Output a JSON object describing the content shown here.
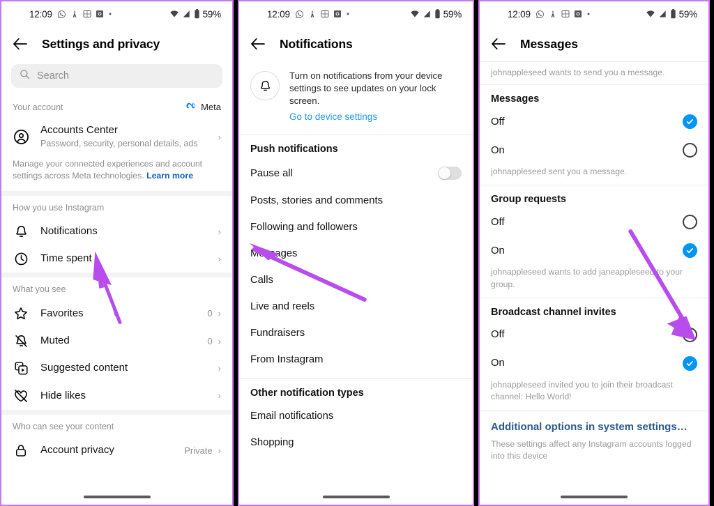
{
  "status_bar": {
    "time": "12:09",
    "battery_pct": "59%",
    "left_icons": [
      "whatsapp-icon",
      "app-icon",
      "photo-app-icon",
      "app-badge-icon",
      "dot-icon"
    ],
    "right_icons": [
      "wifi-icon",
      "signal-icon",
      "battery-icon"
    ]
  },
  "accent": {
    "arrow": "#b84ced",
    "phone_border": "#c979f0",
    "blue": "#0095f6",
    "link_blue": "#2196f3",
    "meta_blue": "#0082fb",
    "system_link": "#2b5a8e"
  },
  "panel_settings": {
    "title": "Settings and privacy",
    "search_placeholder": "Search",
    "search_value": "",
    "sections": [
      {
        "label": "Your account",
        "badge": "Meta",
        "rows": [
          {
            "icon": "account-circle-icon",
            "title": "Accounts Center",
            "sub": "Password, security, personal details, ads",
            "right": "",
            "chevron": true
          }
        ],
        "note": "Manage your connected experiences and account settings across Meta technologies.",
        "note_link": "Learn more"
      },
      {
        "label": "How you use Instagram",
        "rows": [
          {
            "icon": "bell-icon",
            "title": "Notifications",
            "sub": "",
            "right": "",
            "chevron": true
          },
          {
            "icon": "clock-icon",
            "title": "Time spent",
            "sub": "",
            "right": "",
            "chevron": true
          }
        ]
      },
      {
        "label": "What you see",
        "rows": [
          {
            "icon": "star-icon",
            "title": "Favorites",
            "sub": "",
            "right": "0",
            "chevron": true
          },
          {
            "icon": "bell-muted-icon",
            "title": "Muted",
            "sub": "",
            "right": "0",
            "chevron": true
          },
          {
            "icon": "suggested-content-icon",
            "title": "Suggested content",
            "sub": "",
            "right": "",
            "chevron": true
          },
          {
            "icon": "heart-slash-icon",
            "title": "Hide likes",
            "sub": "",
            "right": "",
            "chevron": true
          }
        ]
      },
      {
        "label": "Who can see your content",
        "rows": [
          {
            "icon": "lock-icon",
            "title": "Account privacy",
            "sub": "",
            "right": "Private",
            "chevron": true
          }
        ]
      }
    ]
  },
  "panel_notifications": {
    "title": "Notifications",
    "banner": {
      "icon": "bell-icon",
      "text": "Turn on notifications from your device settings to see updates on your lock screen.",
      "link": "Go to device settings"
    },
    "groups": [
      {
        "heading": "Push notifications",
        "items": [
          {
            "label": "Pause all",
            "control": "toggle",
            "toggle_on": false
          },
          {
            "label": "Posts, stories and comments",
            "control": "none"
          },
          {
            "label": "Following and followers",
            "control": "none"
          },
          {
            "label": "Messages",
            "control": "none"
          },
          {
            "label": "Calls",
            "control": "none"
          },
          {
            "label": "Live and reels",
            "control": "none"
          },
          {
            "label": "Fundraisers",
            "control": "none"
          },
          {
            "label": "From Instagram",
            "control": "none"
          }
        ]
      },
      {
        "heading": "Other notification types",
        "items": [
          {
            "label": "Email notifications",
            "control": "none"
          },
          {
            "label": "Shopping",
            "control": "none"
          }
        ]
      }
    ]
  },
  "panel_messages": {
    "title": "Messages",
    "top_note": "johnappleseed wants to send you a message.",
    "groups": [
      {
        "title": "Messages",
        "options": [
          {
            "label": "Off",
            "selected": true
          },
          {
            "label": "On",
            "selected": false
          }
        ],
        "note": "johnappleseed sent you a message."
      },
      {
        "title": "Group requests",
        "options": [
          {
            "label": "Off",
            "selected": false
          },
          {
            "label": "On",
            "selected": true
          }
        ],
        "note": "johnappleseed wants to add janeappleseed to your group."
      },
      {
        "title": "Broadcast channel invites",
        "options": [
          {
            "label": "Off",
            "selected": false
          },
          {
            "label": "On",
            "selected": true
          }
        ],
        "note": "johnappleseed invited you to join their broadcast channel: Hello World!"
      }
    ],
    "system_link": "Additional options in system settings…",
    "system_note": "These settings affect any Instagram accounts logged into this device"
  }
}
